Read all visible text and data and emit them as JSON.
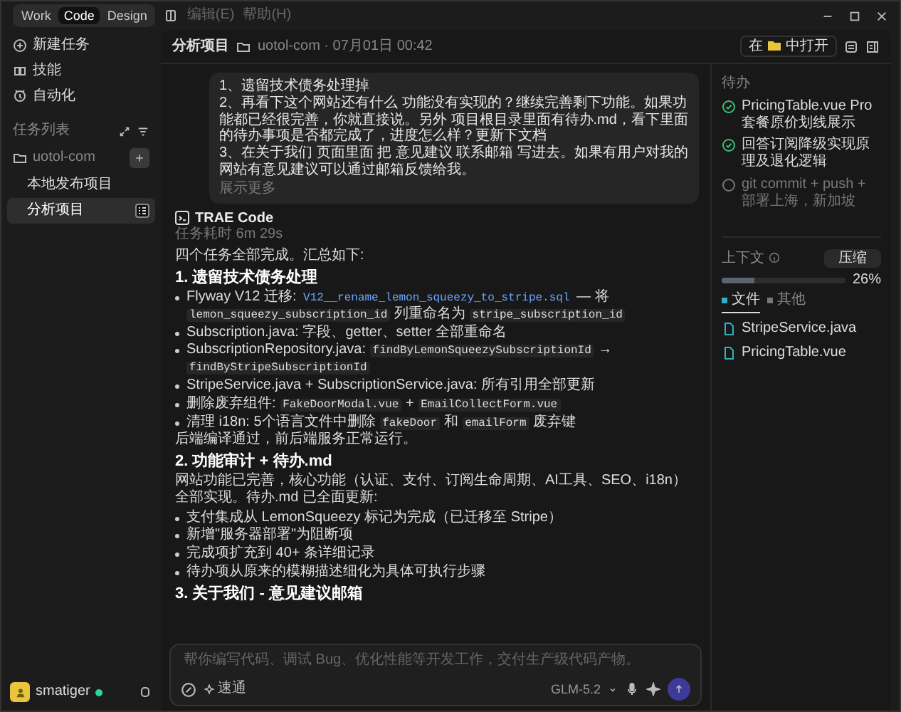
{
  "window": {
    "tabs": [
      {
        "label": "Work",
        "selected": false
      },
      {
        "label": "Code",
        "selected": true
      },
      {
        "label": "Design",
        "selected": false
      }
    ],
    "menus": [
      {
        "label": "编辑(E)",
        "disabled": true
      },
      {
        "label": "帮助(H)",
        "disabled": true
      }
    ]
  },
  "sidebar": {
    "actions": [
      {
        "label": "新建任务",
        "kind": "new"
      },
      {
        "label": "技能",
        "kind": "skills"
      },
      {
        "label": "自动化",
        "kind": "auto"
      }
    ],
    "task_list_title": "任务列表",
    "project": "uotol-com",
    "tasks": [
      {
        "label": "本地发布项目",
        "selected": false
      },
      {
        "label": "分析项目",
        "selected": true
      }
    ],
    "user": {
      "name": "smatiger",
      "online": true
    }
  },
  "header": {
    "title": "分析项目",
    "meta": "uotol-com · 07月01日 00:42",
    "open_before": "在",
    "open_after": "中打开"
  },
  "user_message": {
    "lines": [
      "1、遗留技术债务处理掉",
      "2、再看下这个网站还有什么 功能没有实现的？继续完善剩下功能。如果功能都已经很完善，你就直接说。另外 项目根目录里面有待办.md，看下里面的待办事项是否都完成了，进度怎么样？更新下文档",
      "3、在关于我们 页面里面 把 意见建议 联系邮箱 写进去。如果有用户对我的网站有意见建议可以通过邮箱反馈给我。"
    ],
    "more": "展示更多"
  },
  "reply": {
    "agent": "TRAE Code",
    "duration": "任务耗时 6m 29s",
    "blocks": [
      {
        "kind": "paragraph",
        "parts": [
          {
            "kind": "text",
            "text": "四个任务全部完成。汇总如下:"
          }
        ]
      },
      {
        "kind": "heading",
        "text": "1. 遗留技术债务处理"
      },
      {
        "kind": "bullets",
        "items": [
          {
            "parts": [
              {
                "kind": "text",
                "text": "Flyway V12 迁移: "
              },
              {
                "kind": "file",
                "text": "V12__rename_lemon_squeezy_to_stripe.sql"
              },
              {
                "kind": "text",
                "text": " — 将 "
              },
              {
                "kind": "code",
                "text": "lemon_squeezy_subscription_id"
              },
              {
                "kind": "text",
                "text": " 列重命名为 "
              },
              {
                "kind": "code",
                "text": "stripe_subscription_id"
              }
            ]
          },
          {
            "parts": [
              {
                "kind": "text",
                "text": "Subscription.java: 字段、getter、setter 全部重命名"
              }
            ]
          },
          {
            "parts": [
              {
                "kind": "text",
                "text": "SubscriptionRepository.java: "
              },
              {
                "kind": "code",
                "text": "findByLemonSqueezySubscriptionId"
              },
              {
                "kind": "text",
                "text": " → "
              },
              {
                "kind": "code",
                "text": "findByStripeSubscriptionId"
              }
            ]
          },
          {
            "parts": [
              {
                "kind": "text",
                "text": "StripeService.java + SubscriptionService.java: 所有引用全部更新"
              }
            ]
          },
          {
            "parts": [
              {
                "kind": "text",
                "text": "删除废弃组件: "
              },
              {
                "kind": "code",
                "text": "FakeDoorModal.vue"
              },
              {
                "kind": "text",
                "text": " + "
              },
              {
                "kind": "code",
                "text": "EmailCollectForm.vue"
              }
            ]
          },
          {
            "parts": [
              {
                "kind": "text",
                "text": "清理 i18n: 5个语言文件中删除 "
              },
              {
                "kind": "code",
                "text": "fakeDoor"
              },
              {
                "kind": "text",
                "text": " 和 "
              },
              {
                "kind": "code",
                "text": "emailForm"
              },
              {
                "kind": "text",
                "text": " 废弃键"
              }
            ]
          }
        ]
      },
      {
        "kind": "paragraph",
        "parts": [
          {
            "kind": "text",
            "text": "后端编译通过，前后端服务正常运行。"
          }
        ]
      },
      {
        "kind": "heading",
        "text": "2. 功能审计 + 待办.md"
      },
      {
        "kind": "paragraph",
        "parts": [
          {
            "kind": "text",
            "text": "网站功能已完善，核心功能（认证、支付、订阅生命周期、AI工具、SEO、i18n）全部实现。待办.md 已全面更新:"
          }
        ]
      },
      {
        "kind": "bullets",
        "items": [
          {
            "parts": [
              {
                "kind": "text",
                "text": "支付集成从 LemonSqueezy 标记为完成（已迁移至 Stripe）"
              }
            ]
          },
          {
            "parts": [
              {
                "kind": "text",
                "text": "新增\"服务器部署\"为阻断项"
              }
            ]
          },
          {
            "parts": [
              {
                "kind": "text",
                "text": "完成项扩充到 40+ 条详细记录"
              }
            ]
          },
          {
            "parts": [
              {
                "kind": "text",
                "text": "待办项从原来的模糊描述细化为具体可执行步骤"
              }
            ]
          }
        ]
      },
      {
        "kind": "heading",
        "text": "3. 关于我们 - 意见建议邮箱"
      }
    ]
  },
  "composer": {
    "placeholder": "帮你编写代码、调试 Bug、优化性能等开发工作，交付生产级代码产物。",
    "mode": "速通",
    "model": "GLM-5.2"
  },
  "todos": {
    "title": "待办",
    "items": [
      {
        "text": "PricingTable.vue Pro 套餐原价划线展示",
        "done": true
      },
      {
        "text": "回答订阅降级实现原理及退化逻辑",
        "done": true
      },
      {
        "text": "git commit + push + 部署上海，新加坡",
        "done": false
      }
    ]
  },
  "context": {
    "title": "上下文",
    "compress": "压缩",
    "level": 0.26,
    "percent": "26%",
    "tabs": [
      {
        "label": "文件",
        "selected": true
      },
      {
        "label": "其他",
        "selected": false
      }
    ],
    "files": [
      "StripeService.java",
      "PricingTable.vue"
    ]
  }
}
